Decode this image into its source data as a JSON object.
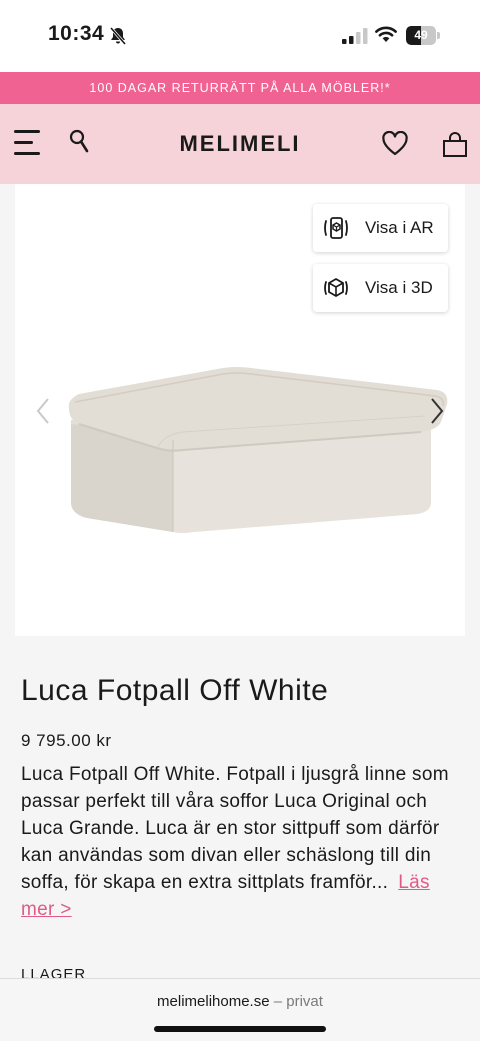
{
  "status_bar": {
    "time": "10:34",
    "battery": "49",
    "battery_level": 0.49
  },
  "promo_banner": {
    "text": "100 DAGAR RETURRÄTT PÅ ALLA MÖBLER!*"
  },
  "header": {
    "logo": "MELIMELI"
  },
  "gallery": {
    "ar_button_label": "Visa i AR",
    "threed_button_label": "Visa i 3D"
  },
  "product": {
    "title": "Luca Fotpall Off White",
    "price": "9 795.00 kr",
    "description": "Luca Fotpall Off White. Fotpall i ljusgrå linne som passar perfekt till våra soffor Luca Original och Luca Grande. Luca är en stor sittpuff som därför kan användas som divan eller schäslong till din soffa, för skapa en extra sittplats framför...",
    "read_more": "Läs mer >",
    "stock_label": "LLAGER"
  },
  "browser": {
    "domain": "melimelihome.se",
    "separator": " – ",
    "mode": "privat"
  },
  "colors": {
    "promo_bg": "#f06292",
    "header_bg": "#f6d3d8",
    "link": "#e05a8a"
  }
}
